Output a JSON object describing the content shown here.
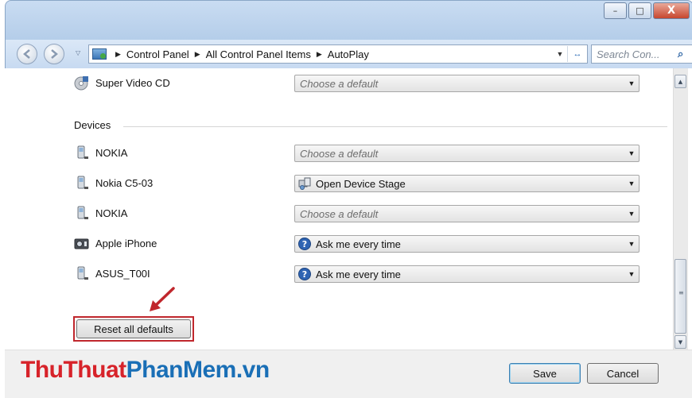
{
  "window": {
    "controls": {
      "minimize": "–",
      "maximize": "□",
      "close": "X"
    }
  },
  "navbar": {
    "breadcrumbs": [
      "Control Panel",
      "All Control Panel Items",
      "AutoPlay"
    ],
    "search_placeholder": "Search Con...",
    "refresh_glyph": "↔"
  },
  "content": {
    "top_row": {
      "name": "Super Video CD",
      "value": "Choose a default",
      "icon": "disc-icon"
    },
    "section_label": "Devices",
    "devices": [
      {
        "name": "NOKIA",
        "value": "Choose a default",
        "placeholder": true,
        "icon": "phone-icon",
        "value_icon": ""
      },
      {
        "name": "Nokia C5-03",
        "value": "Open Device Stage",
        "placeholder": false,
        "icon": "phone-icon",
        "value_icon": "device-stage-icon"
      },
      {
        "name": "NOKIA",
        "value": "Choose a default",
        "placeholder": true,
        "icon": "phone-icon",
        "value_icon": ""
      },
      {
        "name": "Apple iPhone",
        "value": "Ask me every time",
        "placeholder": false,
        "icon": "camera-icon",
        "value_icon": "question-icon"
      },
      {
        "name": "ASUS_T00I",
        "value": "Ask me every time",
        "placeholder": false,
        "icon": "phone-icon",
        "value_icon": "question-icon"
      }
    ],
    "reset_button": "Reset all defaults"
  },
  "footer": {
    "brand_part1": "ThuThuat",
    "brand_part2": "PhanMem.vn",
    "save": "Save",
    "cancel": "Cancel"
  },
  "colors": {
    "highlight": "#c0272d",
    "brand_red": "#d7232a",
    "brand_blue": "#1a6fb6"
  }
}
